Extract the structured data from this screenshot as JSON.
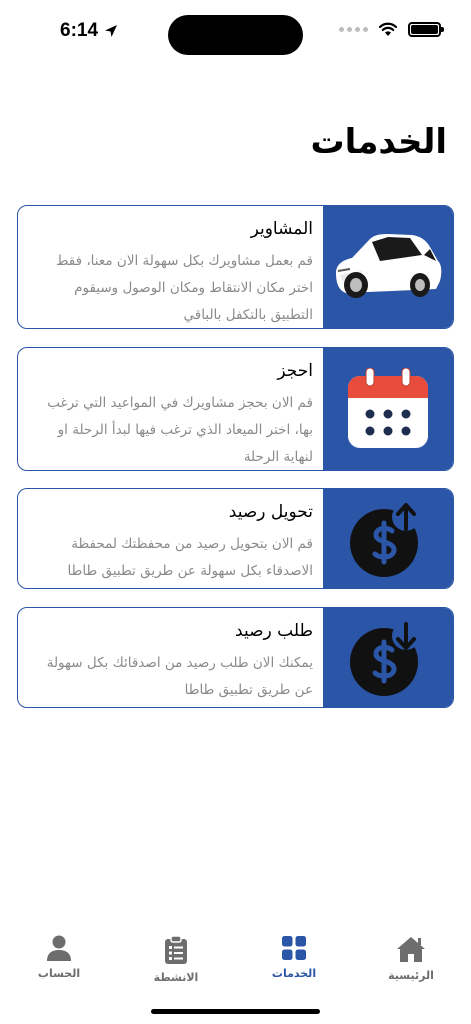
{
  "status_bar": {
    "time": "6:14"
  },
  "page": {
    "title": "الخدمات"
  },
  "services": [
    {
      "title": "المشاوير",
      "description": "قم بعمل مشاويرك بكل سهولة الان معنا، فقط اختر مكان الانتقاط ومكان الوصول وسيقوم التطبيق بالتكفل بالباقي",
      "icon": "car-icon"
    },
    {
      "title": "احجز",
      "description": "قم الان بحجز مشاويرك في المواعيد التي ترغب بها، اختر الميعاد الذي ترغب فيها لبدأ الرحلة او لنهاية الرحلة",
      "icon": "calendar-icon"
    },
    {
      "title": "تحويل رصيد",
      "description": "قم الان بتحويل رصيد من محفظتك لمحفظة الاصدقاء بكل سهولة عن طريق تطبيق طاطا",
      "icon": "dollar-upload-icon"
    },
    {
      "title": "طلب رصيد",
      "description": "يمكنك الان طلب رصيد من اصدقائك بكل سهولة عن طريق تطبيق طاطا",
      "icon": "dollar-download-icon"
    }
  ],
  "tab_bar": {
    "tabs": [
      {
        "label": "الرئيسية",
        "icon": "home-icon",
        "active": false
      },
      {
        "label": "الخدمات",
        "icon": "grid-icon",
        "active": true
      },
      {
        "label": "الانشطة",
        "icon": "clipboard-icon",
        "active": false
      },
      {
        "label": "الحساب",
        "icon": "person-icon",
        "active": false
      }
    ]
  },
  "colors": {
    "primary": "#2b55a6",
    "calendar_red": "#e84c3d",
    "text_muted": "#8a8a8a",
    "icon_dark": "#111111"
  }
}
